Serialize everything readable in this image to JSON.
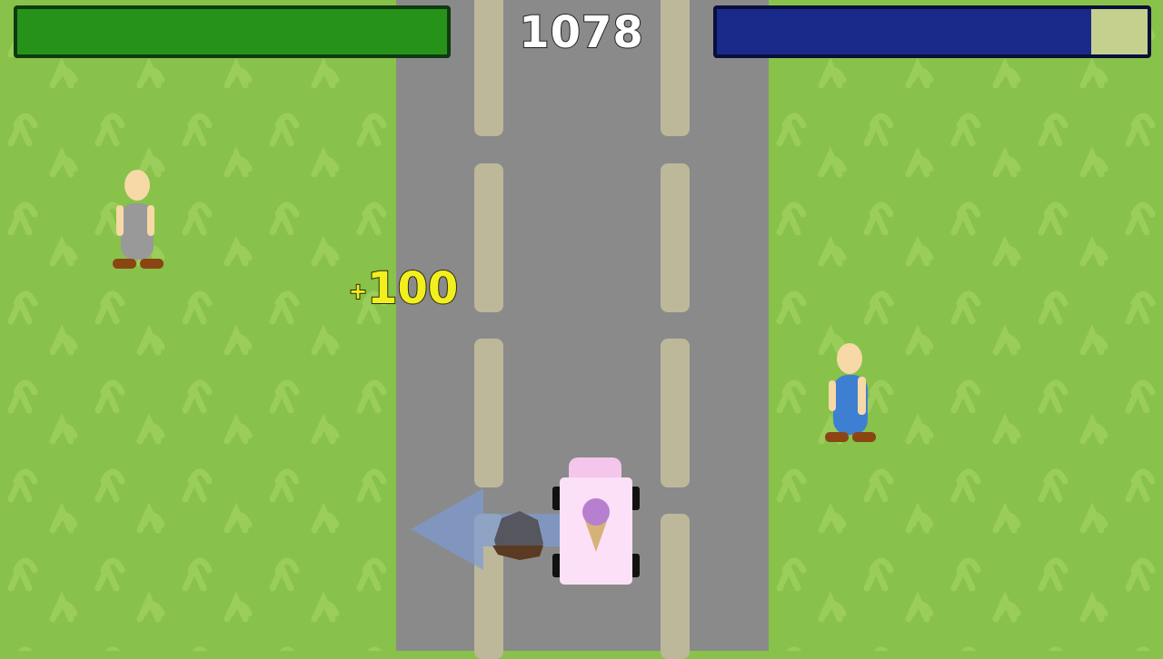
{
  "hud": {
    "score": "1078",
    "health_level": 1.0,
    "fuel_level": 0.87,
    "health_color": "#27921a",
    "fuel_color": "#1a2a8a"
  },
  "popup": {
    "bonus_text": "100"
  },
  "colors": {
    "grass": "#88c24a",
    "road": "#8a8a8a",
    "lane": "#bdb89a",
    "truck": "#fbe0f7"
  },
  "entities": [
    {
      "type": "pedestrian",
      "shirt_color": "#999999"
    },
    {
      "type": "pedestrian",
      "shirt_color": "#3f7fd2"
    },
    {
      "type": "ice-cream-truck",
      "icon": "ice-cream-cone-icon"
    },
    {
      "type": "rock-obstacle"
    },
    {
      "type": "direction-arrow",
      "direction": "left"
    }
  ]
}
